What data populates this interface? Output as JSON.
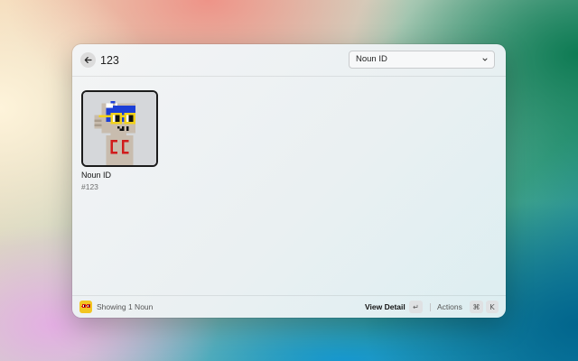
{
  "header": {
    "search_value": "123",
    "dropdown_selected": "Noun ID"
  },
  "grid": {
    "items": [
      {
        "title": "Noun ID",
        "subtitle": "#123"
      }
    ]
  },
  "footer": {
    "status": "Showing 1 Noun",
    "primary_action": "View Detail",
    "primary_key": "↵",
    "actions_label": "Actions",
    "actions_keys": [
      "⌘",
      "K"
    ]
  },
  "colors": {
    "footer_icon_bg": "#f2c521",
    "noun_head_blue": "#1c3fd6",
    "noun_glasses_yellow": "#f2d21b",
    "noun_shirt_red": "#d11b1b"
  }
}
